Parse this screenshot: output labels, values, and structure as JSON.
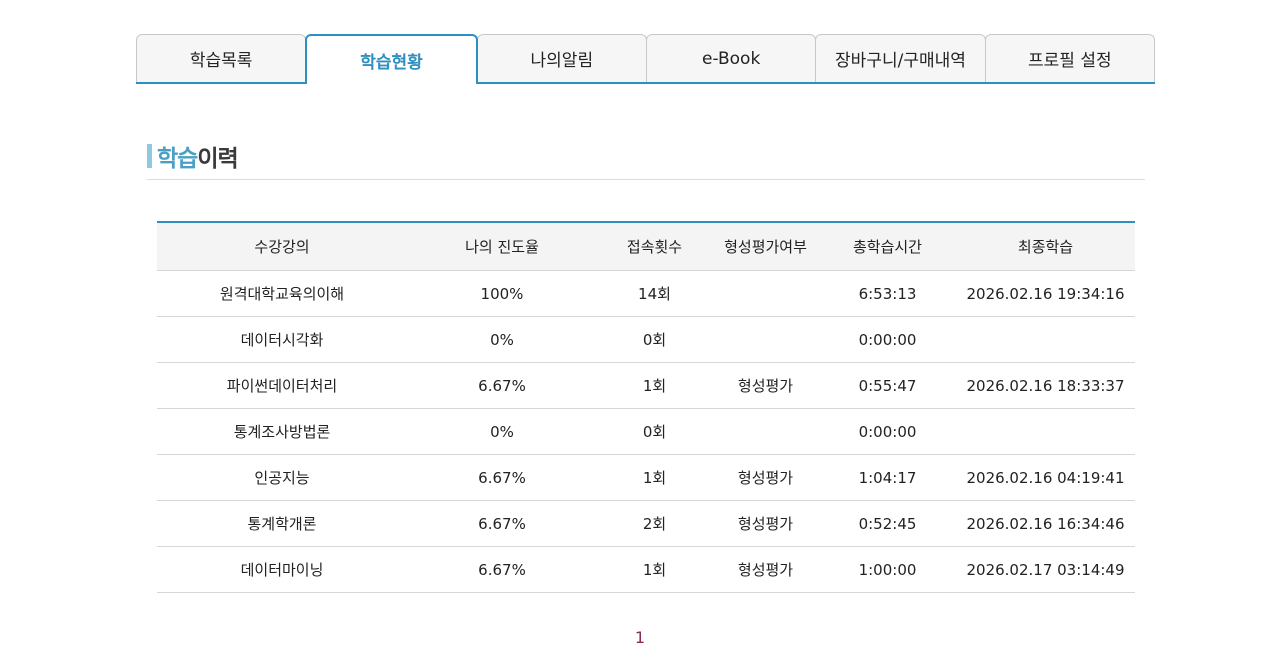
{
  "tabs": [
    {
      "label": "학습목록",
      "active": false
    },
    {
      "label": "학습현황",
      "active": true
    },
    {
      "label": "나의알림",
      "active": false
    },
    {
      "label": "e-Book",
      "active": false
    },
    {
      "label": "장바구니/구매내역",
      "active": false
    },
    {
      "label": "프로필 설정",
      "active": false
    }
  ],
  "section": {
    "title_accent": "학습",
    "title_rest": "이력"
  },
  "table": {
    "headers": [
      "수강강의",
      "나의 진도율",
      "접속횟수",
      "형성평가여부",
      "총학습시간",
      "최종학습"
    ],
    "rows": [
      [
        "원격대학교육의이해",
        "100%",
        "14회",
        "",
        "6:53:13",
        "2026.02.16 19:34:16"
      ],
      [
        "데이터시각화",
        "0%",
        "0회",
        "",
        "0:00:00",
        ""
      ],
      [
        "파이썬데이터처리",
        "6.67%",
        "1회",
        "형성평가",
        "0:55:47",
        "2026.02.16 18:33:37"
      ],
      [
        "통계조사방법론",
        "0%",
        "0회",
        "",
        "0:00:00",
        ""
      ],
      [
        "인공지능",
        "6.67%",
        "1회",
        "형성평가",
        "1:04:17",
        "2026.02.16 04:19:41"
      ],
      [
        "통계학개론",
        "6.67%",
        "2회",
        "형성평가",
        "0:52:45",
        "2026.02.16 16:34:46"
      ],
      [
        "데이터마이닝",
        "6.67%",
        "1회",
        "형성평가",
        "1:00:00",
        "2026.02.17 03:14:49"
      ]
    ]
  },
  "pagination": {
    "current": "1"
  },
  "colors": {
    "accent": "#2f8fbf",
    "title_accent": "#4aa0c4",
    "title_bar": "#8ec9df",
    "page_number": "#8a2a5a"
  }
}
